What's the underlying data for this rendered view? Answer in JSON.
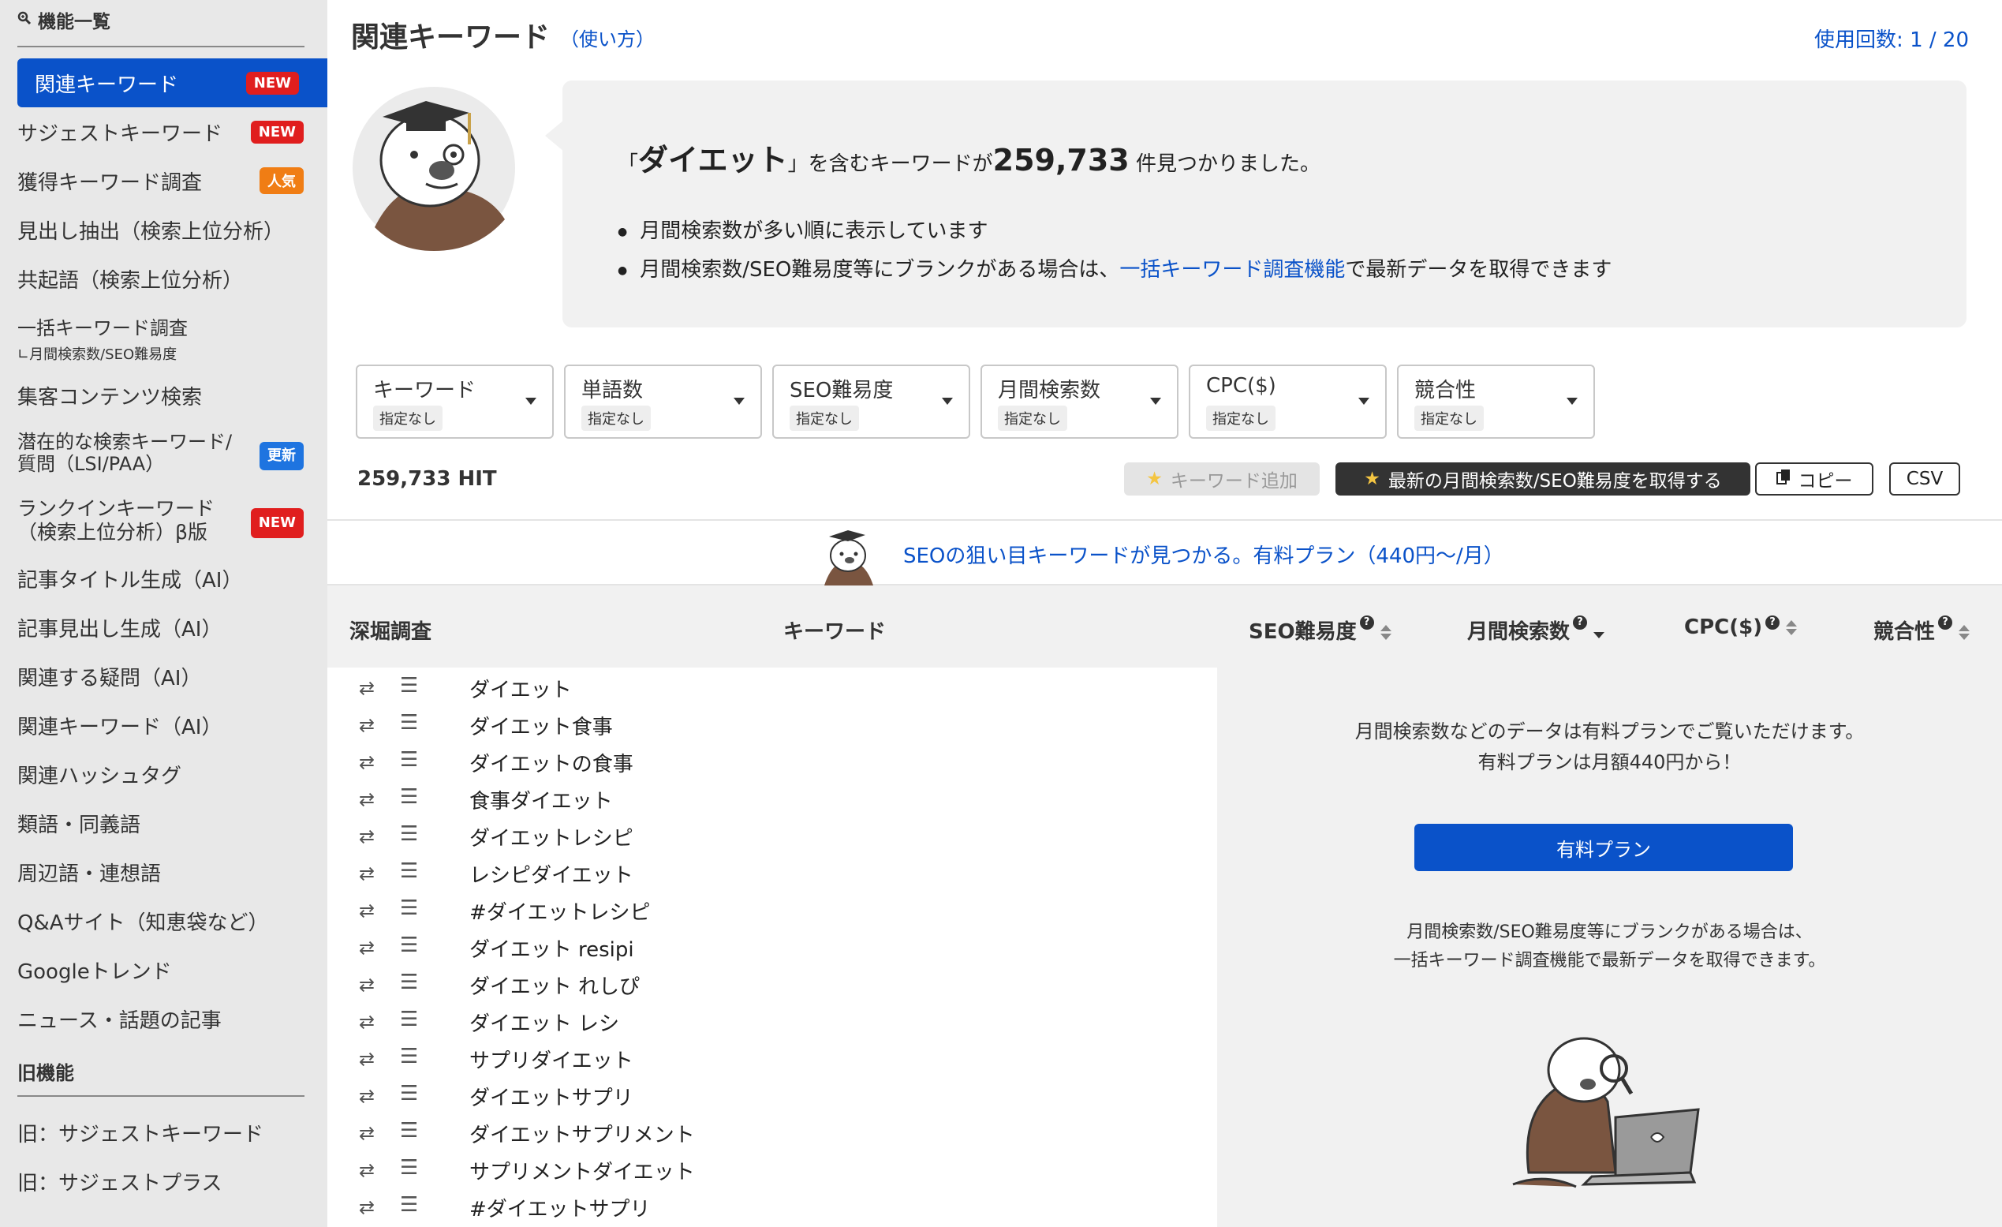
{
  "sidebar": {
    "heading": "機能一覧",
    "items": [
      {
        "label": "関連キーワード",
        "badge": "NEW"
      },
      {
        "label": "サジェストキーワード",
        "badge": "NEW"
      },
      {
        "label": "獲得キーワード調査",
        "badge": "人気"
      },
      {
        "label": "見出し抽出（検索上位分析）"
      },
      {
        "label": "共起語（検索上位分析）"
      },
      {
        "label": "一括キーワード調査",
        "sub": "∟月間検索数/SEO難易度"
      },
      {
        "label": "集客コンテンツ検索"
      },
      {
        "label": "潜在的な検索キーワード/",
        "label2": "質問（LSI/PAA）",
        "badge": "更新"
      },
      {
        "label": "ランクインキーワード",
        "label2": "（検索上位分析）β版",
        "badge": "NEW"
      },
      {
        "label": "記事タイトル生成（AI）"
      },
      {
        "label": "記事見出し生成（AI）"
      },
      {
        "label": "関連する疑問（AI）"
      },
      {
        "label": "関連キーワード（AI）"
      },
      {
        "label": "関連ハッシュタグ"
      },
      {
        "label": "類語・同義語"
      },
      {
        "label": "周辺語・連想語"
      },
      {
        "label": "Q&Aサイト（知恵袋など）"
      },
      {
        "label": "Googleトレンド"
      },
      {
        "label": "ニュース・話題の記事"
      }
    ],
    "old_heading": "旧機能",
    "old_items": [
      {
        "label": "旧：サジェストキーワード"
      },
      {
        "label": "旧：サジェストプラス"
      }
    ]
  },
  "header": {
    "title": "関連キーワード",
    "howto": "（使い方）",
    "usage": "使用回数: 1 / 20"
  },
  "result": {
    "prefix": "「",
    "keyword": "ダイエット",
    "mid": "」を含むキーワードが",
    "count": "259,733",
    "suffix": "件見つかりました。",
    "note1": "月間検索数が多い順に表示しています",
    "note2_pre": "月間検索数/SEO難易度等にブランクがある場合は、",
    "note2_link": "一括キーワード調査機能",
    "note2_post": "で最新データを取得できます"
  },
  "filters": [
    {
      "label": "キーワード",
      "value": "指定なし"
    },
    {
      "label": "単語数",
      "value": "指定なし"
    },
    {
      "label": "SEO難易度",
      "value": "指定なし"
    },
    {
      "label": "月間検索数",
      "value": "指定なし"
    },
    {
      "label": "CPC($)",
      "value": "指定なし"
    },
    {
      "label": "競合性",
      "value": "指定なし"
    }
  ],
  "toolbar": {
    "hits": "259,733 HIT",
    "add_keyword": "キーワード追加",
    "fetch_latest": "最新の月間検索数/SEO難易度を取得する",
    "copy": "コピー",
    "csv": "CSV"
  },
  "promo": {
    "text": "SEOの狙い目キーワードが見つかる。有料プラン（440円〜/月）"
  },
  "table": {
    "headers": {
      "deep": "深堀調査",
      "keyword": "キーワード",
      "seo": "SEO難易度",
      "monthly": "月間検索数",
      "cpc": "CPC($)",
      "competition": "競合性"
    },
    "rows": [
      "ダイエット",
      "ダイエット食事",
      "ダイエットの食事",
      "食事ダイエット",
      "ダイエットレシピ",
      "レシピダイエット",
      "#ダイエットレシピ",
      "ダイエット resipi",
      "ダイエット れしぴ",
      "ダイエット レシ",
      "サプリダイエット",
      "ダイエットサプリ",
      "ダイエットサプリメント",
      "サプリメントダイエット",
      "#ダイエットサプリ"
    ]
  },
  "paid": {
    "msg1": "月間検索数などのデータは有料プランでご覧いただけます。",
    "msg2": "有料プランは月額440円から！",
    "button": "有料プラン",
    "msg3": "月間検索数/SEO難易度等にブランクがある場合は、",
    "msg4": "一括キーワード調査機能で最新データを取得できます。"
  },
  "colors": {
    "accent": "#0a52c9",
    "badge_new": "#e01e1e",
    "badge_popular": "#f07d14",
    "badge_update": "#1e74e0"
  }
}
